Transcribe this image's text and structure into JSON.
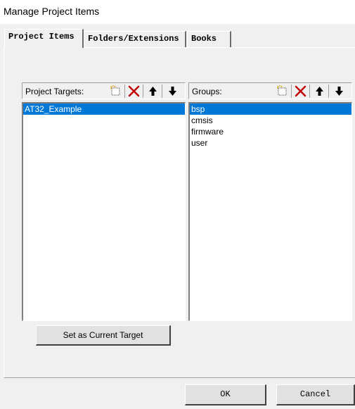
{
  "window": {
    "title": "Manage Project Items"
  },
  "tabs": [
    {
      "label": "Project Items",
      "active": true
    },
    {
      "label": "Folders/Extensions",
      "active": false
    },
    {
      "label": "Books",
      "active": false
    }
  ],
  "targets": {
    "label": "Project Targets:",
    "items": [
      "AT32_Example"
    ],
    "selected": "AT32_Example"
  },
  "groups": {
    "label": "Groups:",
    "items": [
      "bsp",
      "cmsis",
      "firmware",
      "user"
    ],
    "selected": "bsp"
  },
  "toolbar_icons": [
    "new-icon",
    "delete-icon",
    "move-up-icon",
    "move-down-icon"
  ],
  "buttons": {
    "set_target": "Set as Current Target",
    "ok": "OK",
    "cancel": "Cancel"
  },
  "colors": {
    "selection": "#0078d7",
    "delete": "#c00000",
    "dialog_bg": "#f0f0f0"
  }
}
